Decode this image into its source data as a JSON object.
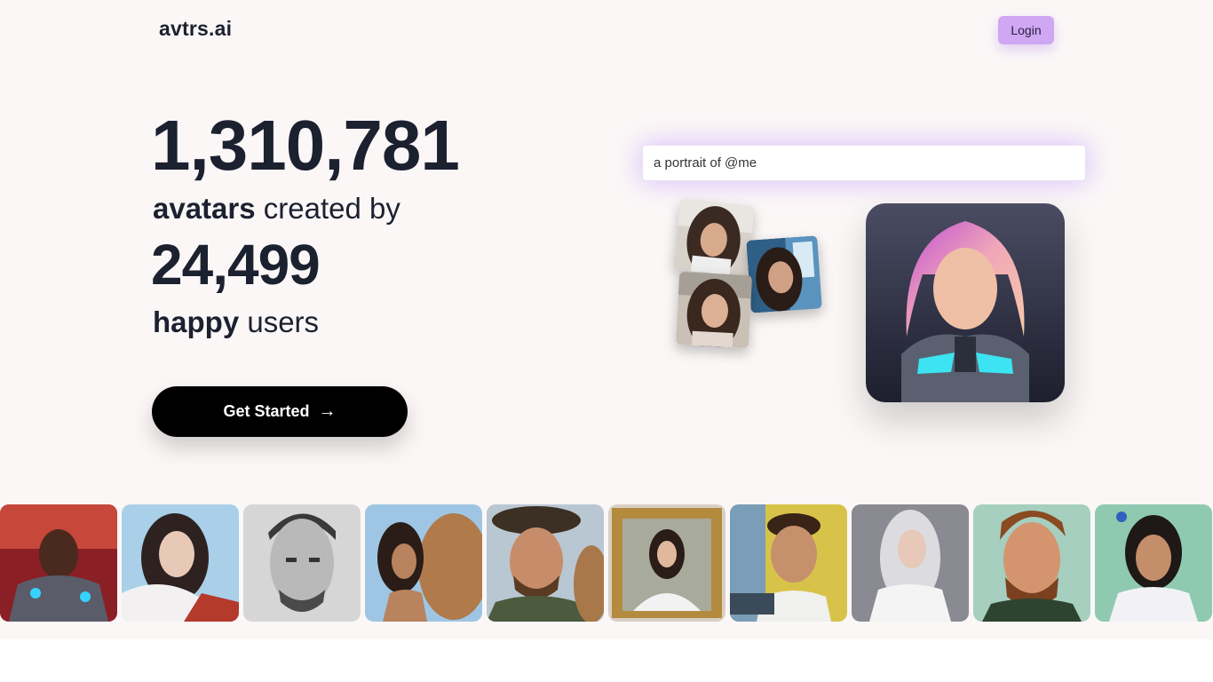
{
  "header": {
    "logo": "avtrs.ai",
    "login_label": "Login"
  },
  "hero": {
    "avatars_count": "1,310,781",
    "avatars_word": "avatars",
    "created_by": " created by",
    "users_count": "24,499",
    "happy_word": "happy",
    "users_word": " users",
    "cta_label": "Get Started",
    "cta_icon": "arrow-right-icon"
  },
  "demo": {
    "prompt_text": "a portrait of @me",
    "input_photos": [
      "selfie-photo-1",
      "selfie-photo-2",
      "selfie-photo-3"
    ],
    "result_image": "cyberpunk-avatar"
  },
  "gallery": {
    "items": [
      "cyber-warrior-avatar",
      "fantasy-woman-avatar",
      "pencil-sketch-man-avatar",
      "woman-with-camel-avatar",
      "man-with-hat-and-camel-avatar",
      "framed-portrait-avatar",
      "man-on-street-avatar",
      "silver-hair-woman-avatar",
      "bearded-man-avatar",
      "girl-in-hoodie-avatar"
    ]
  },
  "colors": {
    "background": "#fbf7f7",
    "text": "#1c2130",
    "login_bg": "#cfa7f3",
    "cta_bg": "#000000",
    "prompt_glow": "#aa6eff"
  }
}
